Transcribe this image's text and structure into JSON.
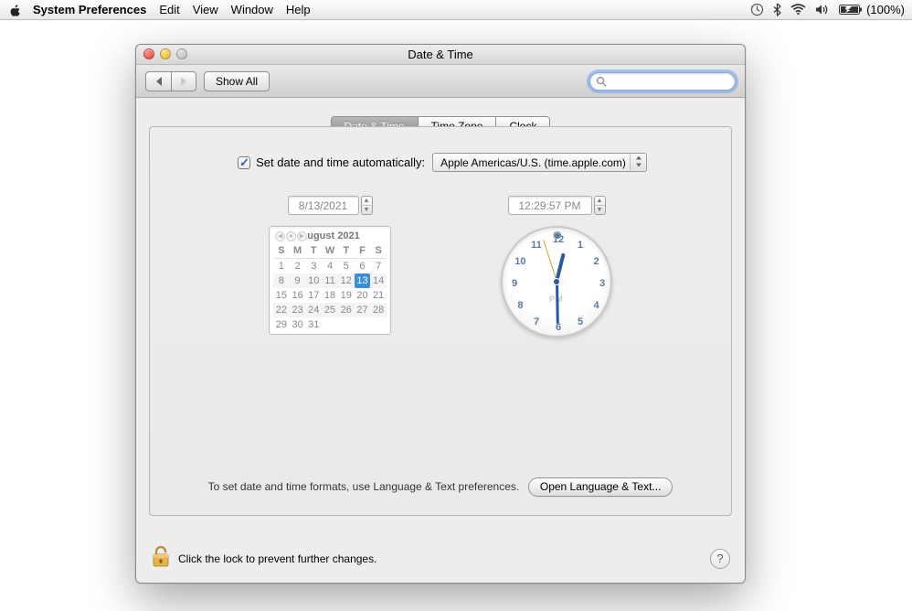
{
  "menubar": {
    "app_name": "System Preferences",
    "items": [
      "Edit",
      "View",
      "Window",
      "Help"
    ],
    "battery": "(100%)"
  },
  "window": {
    "title": "Date & Time",
    "toolbar": {
      "show_all": "Show All",
      "search_placeholder": ""
    }
  },
  "tabs": {
    "items": [
      "Date & Time",
      "Time Zone",
      "Clock"
    ],
    "selected_index": 0
  },
  "auto": {
    "checked": true,
    "label": "Set date and time automatically:",
    "server": "Apple Americas/U.S. (time.apple.com)"
  },
  "date": {
    "value": "8/13/2021"
  },
  "time": {
    "value": "12:29:57 PM",
    "ampm": "PM"
  },
  "calendar": {
    "title": "August 2021",
    "weekdays": [
      "S",
      "M",
      "T",
      "W",
      "T",
      "F",
      "S"
    ],
    "weeks": [
      [
        1,
        2,
        3,
        4,
        5,
        6,
        7
      ],
      [
        8,
        9,
        10,
        11,
        12,
        13,
        14
      ],
      [
        15,
        16,
        17,
        18,
        19,
        20,
        21
      ],
      [
        22,
        23,
        24,
        25,
        26,
        27,
        28
      ],
      [
        29,
        30,
        31,
        "",
        "",
        "",
        ""
      ]
    ],
    "today": 13
  },
  "clock": {
    "hour_angle": 14,
    "minute_angle": 179,
    "second_angle": 342
  },
  "footer": {
    "hint": "To set date and time formats, use Language & Text preferences.",
    "button": "Open Language & Text..."
  },
  "lock": {
    "text": "Click the lock to prevent further changes."
  },
  "help": {
    "label": "?"
  }
}
